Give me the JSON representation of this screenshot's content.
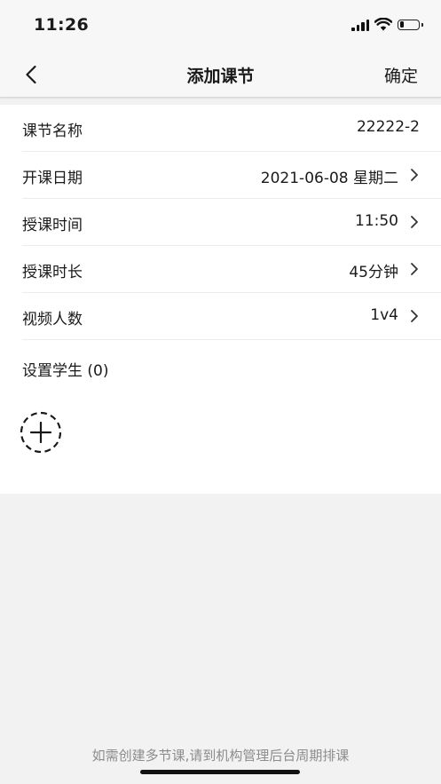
{
  "status_bar": {
    "time": "11:26",
    "battery_level": 0.25
  },
  "nav": {
    "title": "添加课节",
    "confirm_label": "确定",
    "back_icon": "chevron-left-icon"
  },
  "form": {
    "rows": [
      {
        "label": "课节名称",
        "value": "22222-2",
        "has_arrow": false
      },
      {
        "label": "开课日期",
        "value": "2021-06-08 星期二",
        "has_arrow": true
      },
      {
        "label": "授课时间",
        "value": "11:50",
        "has_arrow": true
      },
      {
        "label": "授课时长",
        "value": "45分钟",
        "has_arrow": true
      },
      {
        "label": "视频人数",
        "value": "1v4",
        "has_arrow": true
      }
    ],
    "students_label": "设置学生 (0)",
    "add_icon": "add-circle-dashed-icon"
  },
  "footer": {
    "hint": "如需创建多节课,请到机构管理后台周期排课"
  },
  "colors": {
    "background": "#f2f2f2",
    "card": "#ffffff",
    "hint_text": "#8c8c8c"
  }
}
